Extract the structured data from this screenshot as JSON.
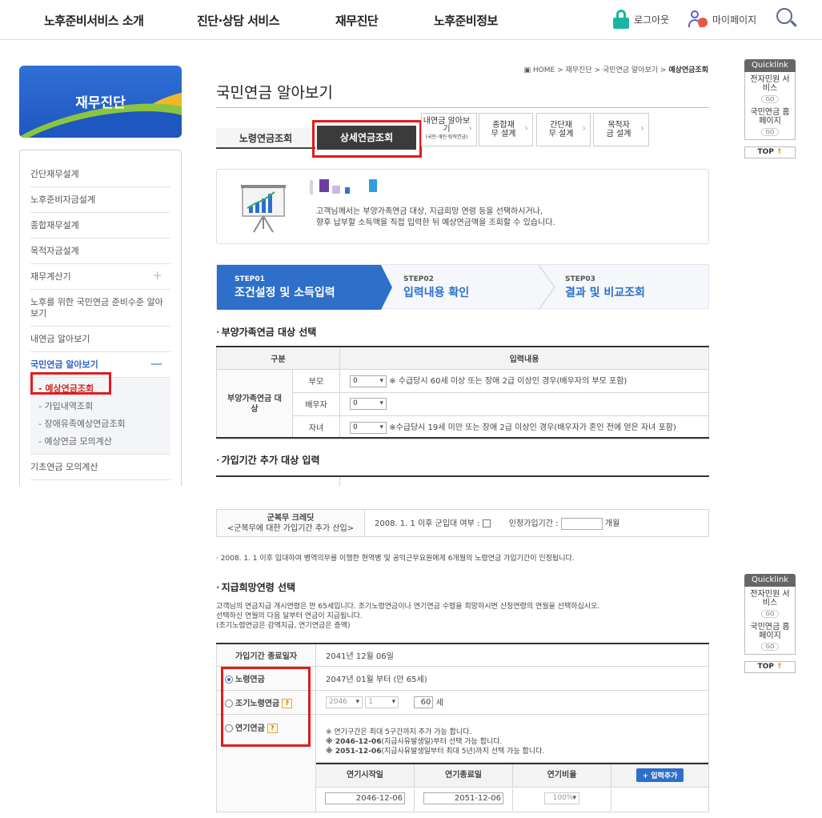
{
  "topnav": {
    "menus": [
      "노후준비서비스 소개",
      "진단·상담 서비스",
      "재무진단",
      "노후준비정보"
    ],
    "logout": "로그아웃",
    "mypage": "마이페이지"
  },
  "sidebar": {
    "banner": "재무진단",
    "items": [
      "간단재무설계",
      "노후준비자금설계",
      "종합재무설계",
      "목적자금설계",
      "재무계산기",
      "노후를 위한 국민연금 준비수준 알아보기",
      "내연금 알아보기",
      "국민연금 알아보기",
      "기초연금 모의계산"
    ],
    "plus": "+",
    "minus": "—",
    "subitems": [
      "- 예상연금조회",
      "- 가입내역조회",
      "- 장애유족예상연금조회",
      "- 예상연금 모의계산"
    ]
  },
  "quicklink": {
    "title": "Quicklink",
    "link1": "전자민원 서비스",
    "link2": "국민연금 홈페이지",
    "go": "GO",
    "top": "TOP"
  },
  "breadcrumb": {
    "home": "HOME",
    "c1": "재무진단",
    "c2": "국민연금 알아보기",
    "c3": "예상연금조회",
    "sep": ">"
  },
  "main": {
    "title": "국민연금 알아보기",
    "tabs": {
      "old_age": "노령연금조회",
      "detail": "상세연금조회",
      "my_pension": "내연금 알아보기",
      "my_pension_sub": "(국민·개인·퇴직연금)",
      "comprehensive": "종합재무 설계",
      "simple": "간단재무 설계",
      "purpose": "목적자금 설계"
    },
    "info_line1": "고객님께서는 부양가족연금 대상, 지급희망 연령 등을 선택하시거나,",
    "info_line2": "향후 납부할 소득액을 직접 입력한 뒤 예상연금액을 조회할 수 있습니다.",
    "steps": [
      {
        "num": "STEP01",
        "label": "조건설정 및 소득입력"
      },
      {
        "num": "STEP02",
        "label": "입력내용 확인"
      },
      {
        "num": "STEP03",
        "label": "결과 및 비교조회"
      }
    ]
  },
  "dependents": {
    "title": "부양가족연금 대상 선택",
    "h1": "구분",
    "h2": "입력내용",
    "group": "부양가족연금 대상",
    "rows": [
      {
        "label": "부모",
        "value": "0",
        "desc": "※ 수급당시 60세 이상 또는 장애 2급 이상인 경우(배우자의 부모 포함)"
      },
      {
        "label": "배우자",
        "value": "0",
        "desc": ""
      },
      {
        "label": "자녀",
        "value": "0",
        "desc": "※수급당시 19세 미만 또는 장애 2급 이상인 경우(배우자가 혼인 전에 얻은 자녀 포함)"
      }
    ]
  },
  "period": {
    "title": "가입기간 추가 대상 입력",
    "military_label": "군복무 크레딧",
    "military_sub": "<군복무에 대한 가입기간 추가 산입>",
    "military_q": "2008. 1. 1 이후 군입대 여부 :",
    "recognized": "인정가입기간 :",
    "months": "개월",
    "note": "· 2008. 1. 1 이후 입대하여 병역의무를 이행한 현역병 및 공익근무요원에게 6개월의 노령연금 가입기간이 인정됩니다."
  },
  "payment": {
    "title": "지급희망연령 선택",
    "desc1": "고객님의 연금지급 개시연령은 만 65세입니다. 조기노령연금이나 연기연금 수령을 희망하시면 신청연령의 연월을 선택하십시오.",
    "desc2": "선택하신 연월의 다음 달부터 연금이 지급됩니다.",
    "desc3": "(조기노령연금은 감액지급, 연기연금은 증액)",
    "end_date_label": "가입기간 종료일자",
    "end_date": "2041년 12월 06일",
    "opt_normal": "노령연금",
    "opt_normal_desc": "2047년 01월 부터 (만 65세)",
    "opt_early": "조기노령연금",
    "early_year": "2046",
    "early_month": "1",
    "early_age": "60",
    "age_unit": "세",
    "opt_defer": "연기연금",
    "help": "?",
    "defer_note1": "※ 연기구간은 최대 5구간까지 추가 가능 합니다.",
    "defer_note2_b": "※ 2046-12-06",
    "defer_note2": "(지급사유발생일)부터 선택 가능 합니다.",
    "defer_note3_b": "※ 2051-12-06",
    "defer_note3": "(지급사유발생일부터 최대 5년)까지 선택 가능 합니다.",
    "col_start": "연기시작일",
    "col_end": "연기종료일",
    "col_ratio": "연기비율",
    "add_btn": "+ 입력추가",
    "start_val": "2046-12-06",
    "end_val": "2051-12-06",
    "ratio_val": "100%"
  }
}
